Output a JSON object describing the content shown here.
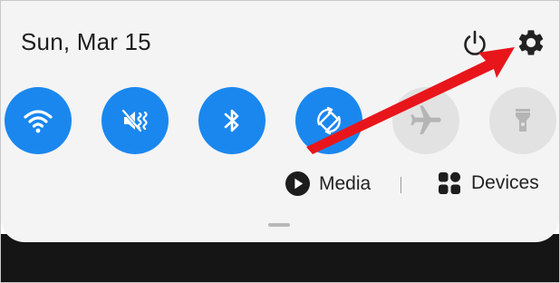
{
  "status": {
    "date": "Sun, Mar 15"
  },
  "header_icons": {
    "power": "power-icon",
    "settings": "gear-icon"
  },
  "quick_tiles": [
    {
      "icon": "wifi-icon",
      "state": "on"
    },
    {
      "icon": "sound-mute-icon",
      "state": "on"
    },
    {
      "icon": "bluetooth-icon",
      "state": "on"
    },
    {
      "icon": "auto-rotate-icon",
      "state": "on"
    },
    {
      "icon": "airplane-icon",
      "state": "off"
    },
    {
      "icon": "flashlight-icon",
      "state": "off"
    }
  ],
  "controls": {
    "media_label": "Media",
    "devices_label": "Devices"
  },
  "colors": {
    "tile_on": "#1a87ef",
    "tile_off": "#e2e2e2",
    "annotation_arrow": "#e8161b"
  }
}
